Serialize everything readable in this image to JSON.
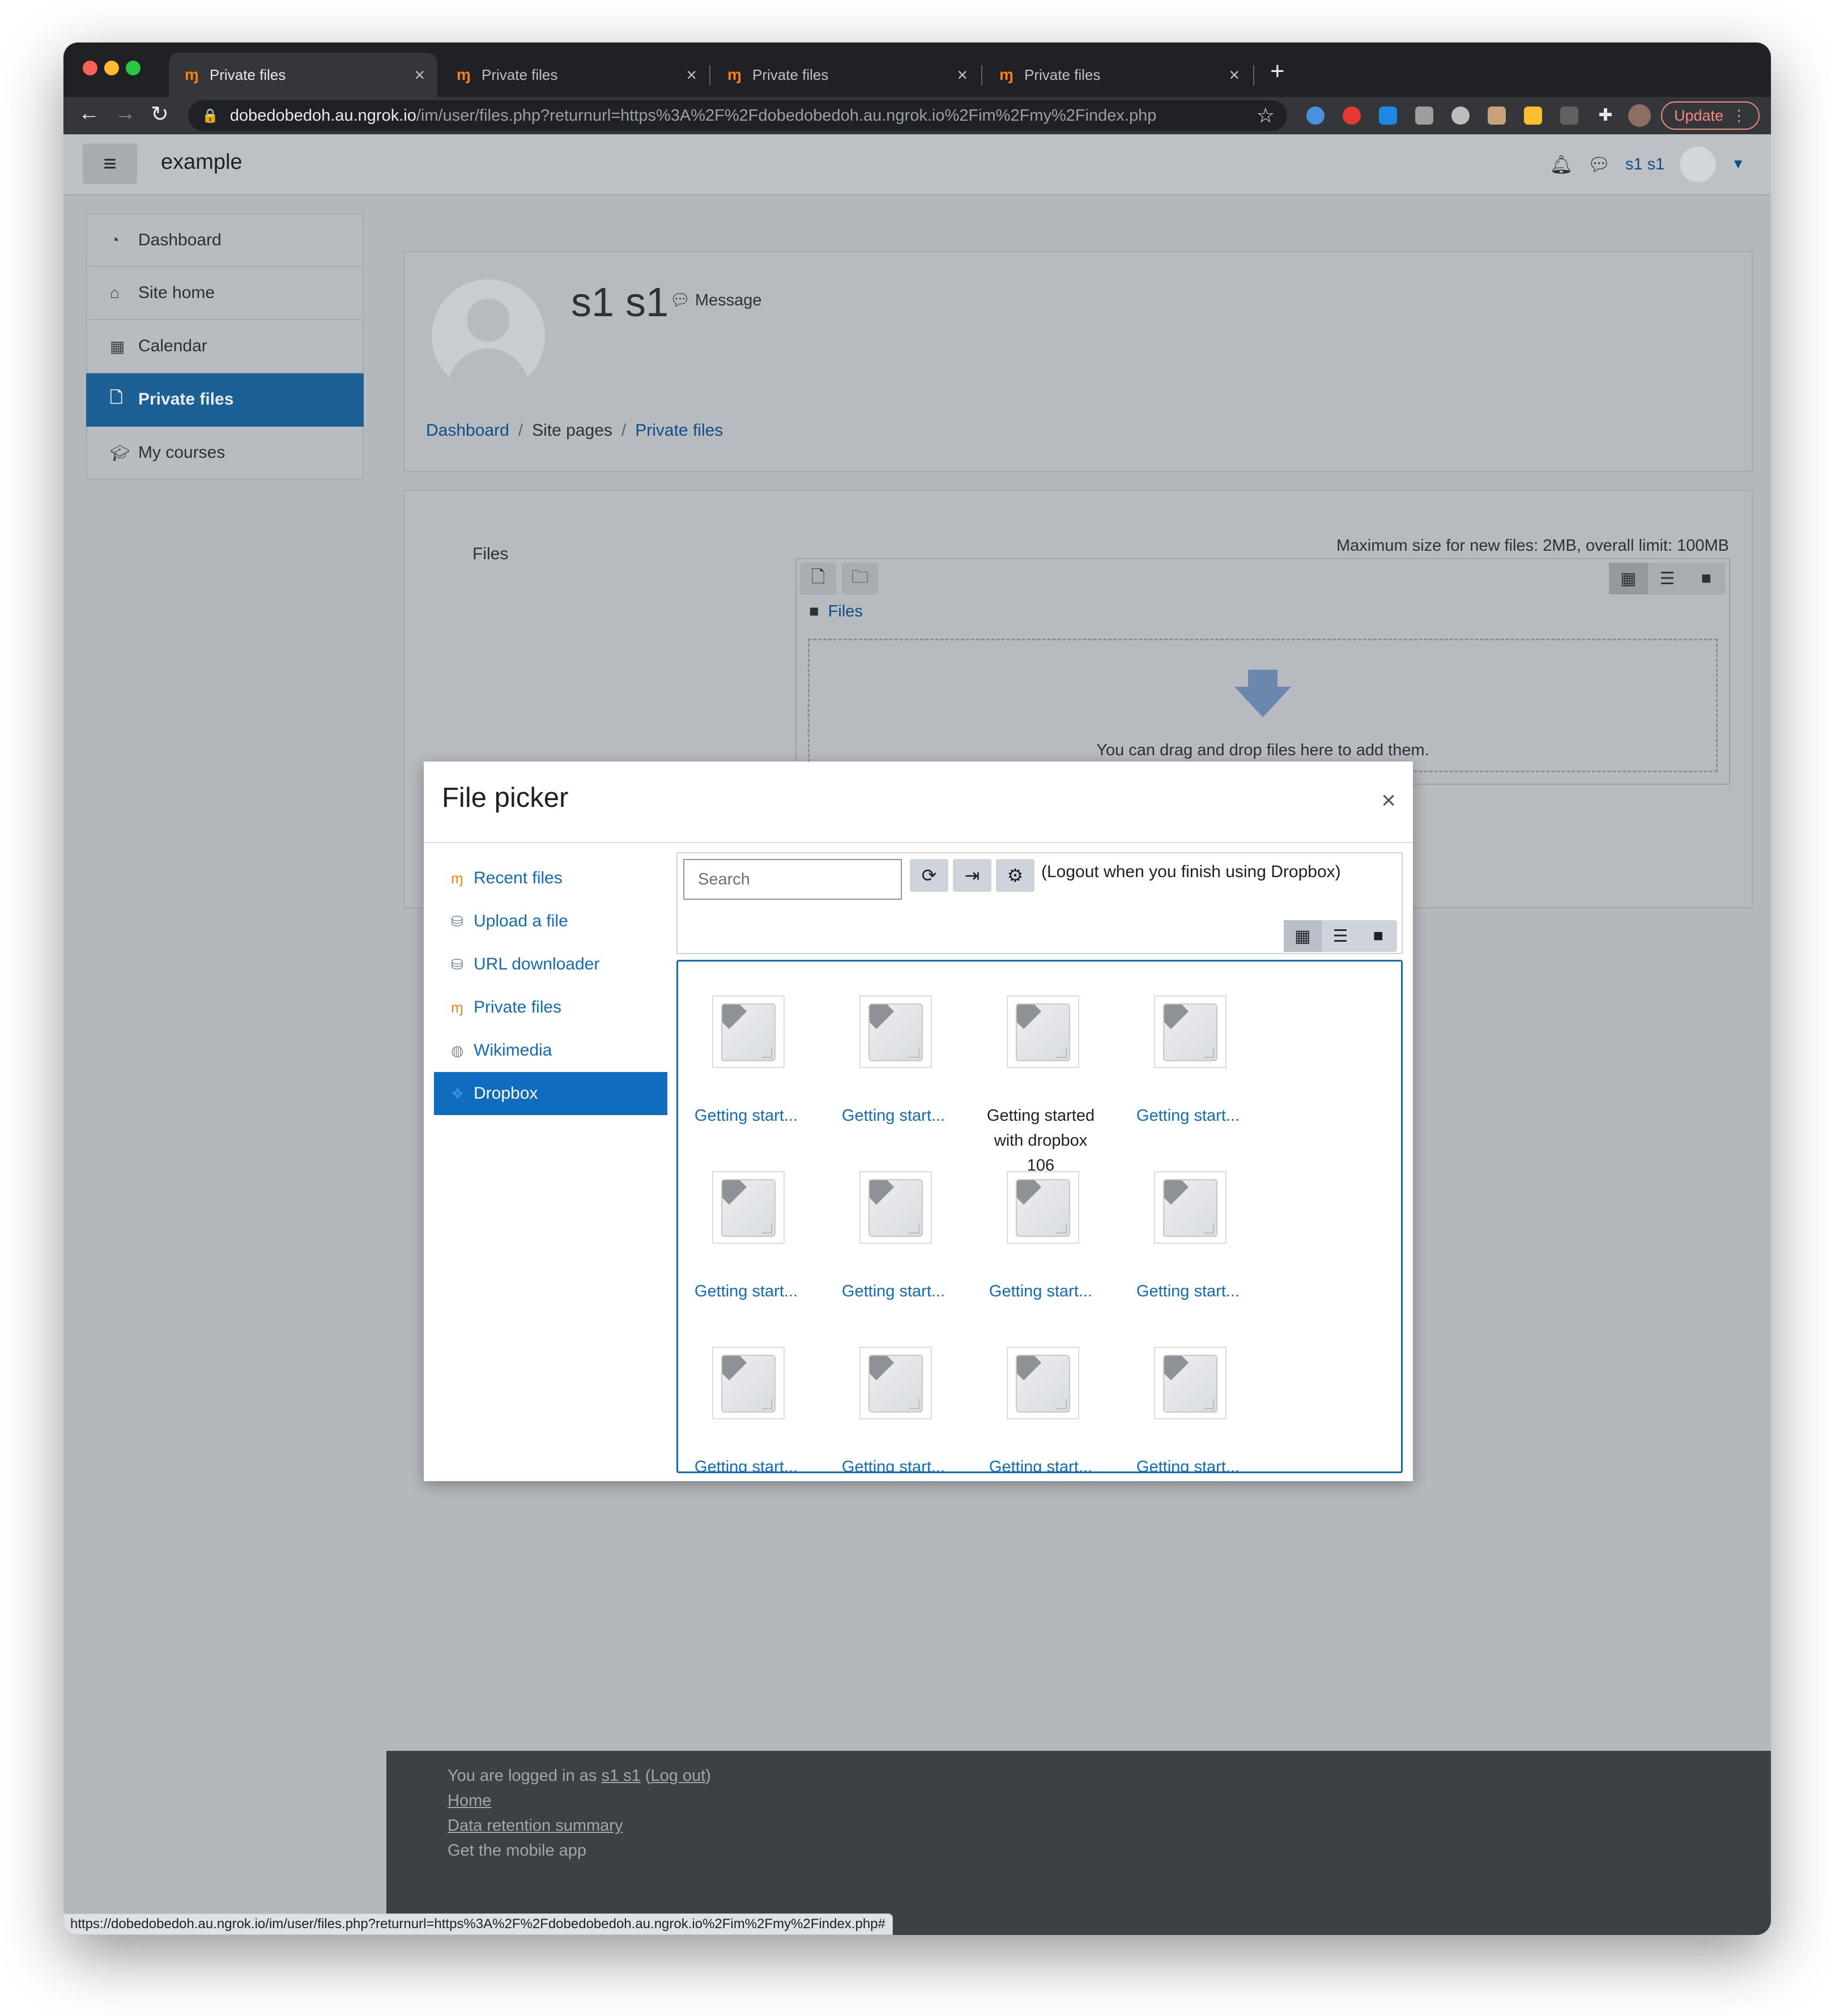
{
  "browser": {
    "tabs": [
      {
        "label": "Private files",
        "favicon": "moodle-icon"
      },
      {
        "label": "Private files",
        "favicon": "moodle-icon"
      },
      {
        "label": "Private files",
        "favicon": "moodle-icon"
      },
      {
        "label": "Private files",
        "favicon": "moodle-icon"
      }
    ],
    "url_host": "dobedobedoh.au.ngrok.io",
    "url_path": "/im/user/files.php?returnurl=https%3A%2F%2Fdobedobedoh.au.ngrok.io%2Fim%2Fmy%2Findex.php",
    "update_label": "Update",
    "status_url": "https://dobedobedoh.au.ngrok.io/im/user/files.php?returnurl=https%3A%2F%2Fdobedobedoh.au.ngrok.io%2Fim%2Fmy%2Findex.php#"
  },
  "navbar": {
    "site_name": "example",
    "user_name": "s1 s1"
  },
  "leftnav": {
    "items": [
      {
        "label": "Dashboard",
        "icon": "dashboard-icon",
        "active": false
      },
      {
        "label": "Site home",
        "icon": "home-icon",
        "active": false
      },
      {
        "label": "Calendar",
        "icon": "calendar-icon",
        "active": false
      },
      {
        "label": "Private files",
        "icon": "file-icon",
        "active": true
      },
      {
        "label": "My courses",
        "icon": "graduation-cap-icon",
        "active": false
      }
    ]
  },
  "header": {
    "full_name": "s1 s1",
    "message_label": "Message",
    "breadcrumbs": [
      "Dashboard",
      "Site pages",
      "Private files"
    ]
  },
  "filemanager": {
    "label": "Files",
    "max_size": "Maximum size for new files: 2MB, overall limit: 100MB",
    "path_root": "Files",
    "drop_text": "You can drag and drop files here to add them."
  },
  "dialog": {
    "title": "File picker",
    "repositories": [
      {
        "label": "Recent files",
        "icon": "moodle-icon",
        "active": false
      },
      {
        "label": "Upload a file",
        "icon": "upload-icon",
        "active": false
      },
      {
        "label": "URL downloader",
        "icon": "url-downloader-icon",
        "active": false
      },
      {
        "label": "Private files",
        "icon": "moodle-icon",
        "active": false
      },
      {
        "label": "Wikimedia",
        "icon": "wikimedia-icon",
        "active": false
      },
      {
        "label": "Dropbox",
        "icon": "dropbox-icon",
        "active": true
      }
    ],
    "search_placeholder": "Search",
    "logout_note": "(Logout when you finish using Dropbox)",
    "files": [
      {
        "label": "Getting start...",
        "hover": false
      },
      {
        "label": "Getting start...",
        "hover": false
      },
      {
        "label": "Getting started with dropbox 106",
        "hover": true
      },
      {
        "label": "Getting start...",
        "hover": false
      },
      {
        "label": "Getting start...",
        "hover": false
      },
      {
        "label": "Getting start...",
        "hover": false
      },
      {
        "label": "Getting start...",
        "hover": false
      },
      {
        "label": "Getting start...",
        "hover": false
      },
      {
        "label": "Getting start...",
        "hover": false
      },
      {
        "label": "Getting start...",
        "hover": false
      },
      {
        "label": "Getting start...",
        "hover": false
      },
      {
        "label": "Getting start...",
        "hover": false
      }
    ]
  },
  "footer": {
    "logged_in_prefix": "You are logged in as",
    "user_link": "s1 s1",
    "logout_link": "Log out",
    "home_link": "Home",
    "data_retention_link": "Data retention summary",
    "mobile_app_link": "Get the mobile app"
  },
  "colors": {
    "accent": "#0f6cbf",
    "moodle_orange": "#f98012",
    "nav_active": "#1b5f94"
  }
}
